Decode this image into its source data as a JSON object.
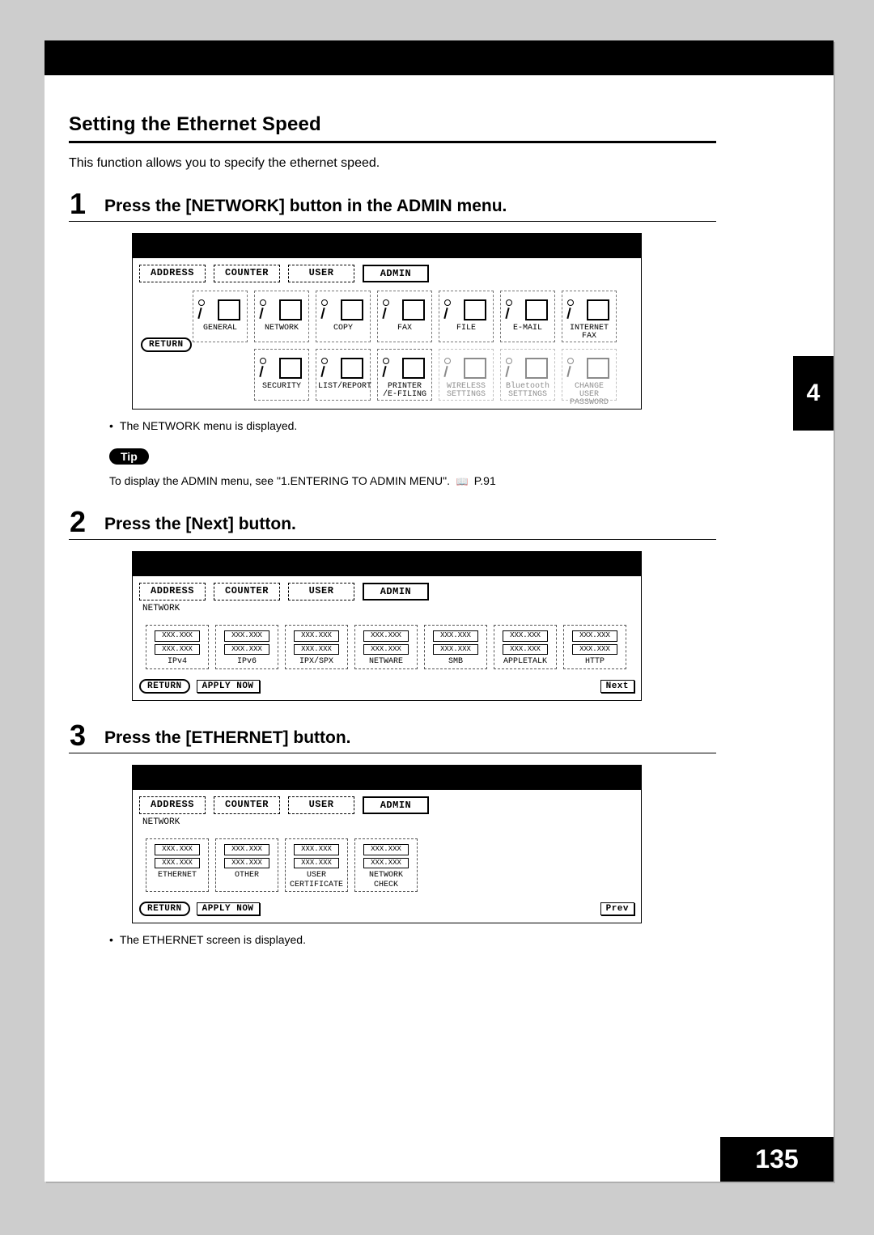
{
  "heading": "Setting the Ethernet Speed",
  "description": "This function allows you to specify the ethernet speed.",
  "chapter": "4",
  "page_number": "135",
  "tabs": [
    "ADDRESS",
    "COUNTER",
    "USER",
    "ADMIN"
  ],
  "tabs_active_index": 3,
  "return_label": "RETURN",
  "applynow_label": "APPLY NOW",
  "next_label": "Next",
  "prev_label": "Prev",
  "tip_badge": "Tip",
  "placeholder": "XXX.XXX",
  "crumb_network": "NETWORK",
  "steps": {
    "1": {
      "title": "Press the [NETWORK] button in the ADMIN menu.",
      "after_bullet": "The NETWORK menu is displayed.",
      "tip_text_1": "To display the ADMIN menu, see \"1.ENTERING TO ADMIN MENU\".",
      "tip_text_2": "P.91",
      "icons_row1": [
        "GENERAL",
        "NETWORK",
        "COPY",
        "FAX",
        "FILE",
        "E-MAIL",
        "INTERNET FAX"
      ],
      "icons_row2": [
        "SECURITY",
        "LIST/REPORT",
        "PRINTER /E-FILING",
        "WIRELESS SETTINGS",
        "Bluetooth SETTINGS",
        "CHANGE USER PASSWORD"
      ]
    },
    "2": {
      "title": "Press the [Next] button.",
      "cells": [
        "IPv4",
        "IPv6",
        "IPX/SPX",
        "NETWARE",
        "SMB",
        "APPLETALK",
        "HTTP"
      ]
    },
    "3": {
      "title": "Press the [ETHERNET] button.",
      "after_bullet": "The ETHERNET screen is displayed.",
      "cells": [
        "ETHERNET",
        "OTHER",
        "USER CERTIFICATE",
        "NETWORK CHECK"
      ]
    }
  }
}
